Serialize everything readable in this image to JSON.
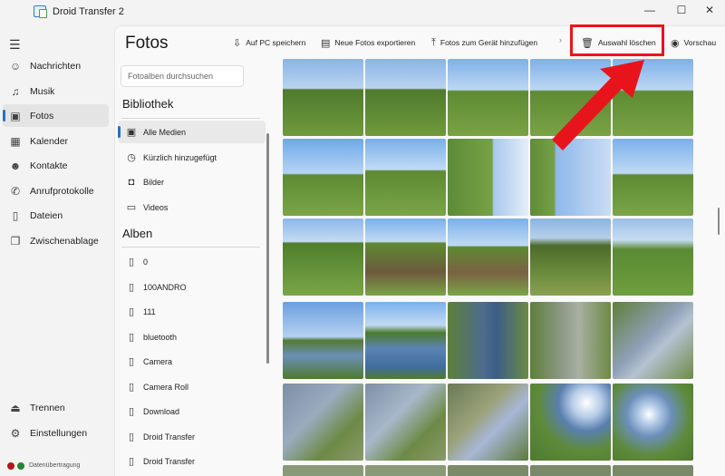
{
  "window": {
    "title": "Droid Transfer 2",
    "minimize": "—",
    "maximize": "☐",
    "close": "✕"
  },
  "sidebar": {
    "items": [
      {
        "label": "Nachrichten",
        "icon": "chat-icon",
        "glyph": "☺"
      },
      {
        "label": "Musik",
        "icon": "music-icon",
        "glyph": "♫"
      },
      {
        "label": "Fotos",
        "icon": "photo-icon",
        "glyph": "▣"
      },
      {
        "label": "Kalender",
        "icon": "calendar-icon",
        "glyph": "▦"
      },
      {
        "label": "Kontakte",
        "icon": "contacts-icon",
        "glyph": "☻"
      },
      {
        "label": "Anrufprotokolle",
        "icon": "phone-icon",
        "glyph": "✆"
      },
      {
        "label": "Dateien",
        "icon": "file-icon",
        "glyph": "▯"
      },
      {
        "label": "Zwischenablage",
        "icon": "clipboard-icon",
        "glyph": "❐"
      }
    ],
    "bottom": [
      {
        "label": "Trennen",
        "icon": "eject-icon",
        "glyph": "⏏"
      },
      {
        "label": "Einstellungen",
        "icon": "gear-icon",
        "glyph": "⚙"
      }
    ],
    "status": "Datenübertragung",
    "status_colors": [
      "#b01818",
      "#1e8a2e"
    ]
  },
  "main": {
    "title": "Fotos",
    "toolbar": [
      {
        "label": "Auf PC speichern",
        "icon": "save-pc-icon",
        "glyph": "⇩"
      },
      {
        "label": "Neue Fotos exportieren",
        "icon": "export-icon",
        "glyph": "▤"
      },
      {
        "label": "Fotos zum Gerät hinzufügen",
        "icon": "upload-icon",
        "glyph": "⤒"
      },
      {
        "label": "Auswahl löschen",
        "icon": "trash-icon",
        "glyph": "🗑"
      },
      {
        "label": "Vorschau",
        "icon": "eye-icon",
        "glyph": "◉"
      }
    ],
    "highlight_color": "#e8141c"
  },
  "albums": {
    "search_placeholder": "Fotoalben durchsuchen",
    "library_header": "Bibliothek",
    "library": [
      {
        "label": "Alle Medien",
        "icon": "image-icon",
        "glyph": "▣"
      },
      {
        "label": "Kürzlich hinzugefügt",
        "icon": "recent-icon",
        "glyph": "◷"
      },
      {
        "label": "Bilder",
        "icon": "camera-icon",
        "glyph": "◘"
      },
      {
        "label": "Videos",
        "icon": "video-icon",
        "glyph": "▭"
      }
    ],
    "albums_header": "Alben",
    "items": [
      "0",
      "100ANDRO",
      "111",
      "bluetooth",
      "Camera",
      "Camera Roll",
      "Download",
      "Droid Transfer",
      "Droid Transfer"
    ]
  }
}
